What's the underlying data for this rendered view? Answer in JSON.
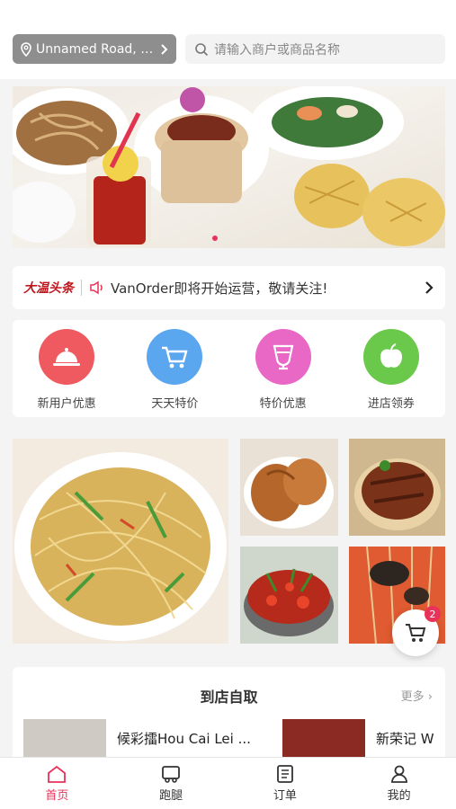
{
  "header": {
    "location": "Unnamed Road, X...",
    "search_placeholder": "请输入商户或商品名称"
  },
  "notice": {
    "brand": "大温头条",
    "message": "VanOrder即将开始运营，敬请关注!"
  },
  "categories": [
    {
      "label": "新用户优惠",
      "icon": "dish-cover-icon",
      "color": "#ef5a60"
    },
    {
      "label": "天天特价",
      "icon": "cart-icon",
      "color": "#5aa6ef"
    },
    {
      "label": "特价优惠",
      "icon": "drink-icon",
      "color": "#e968c6"
    },
    {
      "label": "进店领券",
      "icon": "apple-icon",
      "color": "#6ac94a"
    }
  ],
  "pickup": {
    "title": "到店自取",
    "more": "更多",
    "shops": [
      {
        "name": "候彩擂Hou Cai Lei ..."
      },
      {
        "name": "新荣记 W"
      }
    ]
  },
  "cart": {
    "count": "2"
  },
  "tabs": [
    {
      "label": "首页",
      "icon": "home-icon"
    },
    {
      "label": "跑腿",
      "icon": "delivery-icon"
    },
    {
      "label": "订单",
      "icon": "orders-icon"
    },
    {
      "label": "我的",
      "icon": "profile-icon"
    }
  ],
  "colors": {
    "accent": "#e8325a",
    "brand_red": "#c0151c"
  }
}
